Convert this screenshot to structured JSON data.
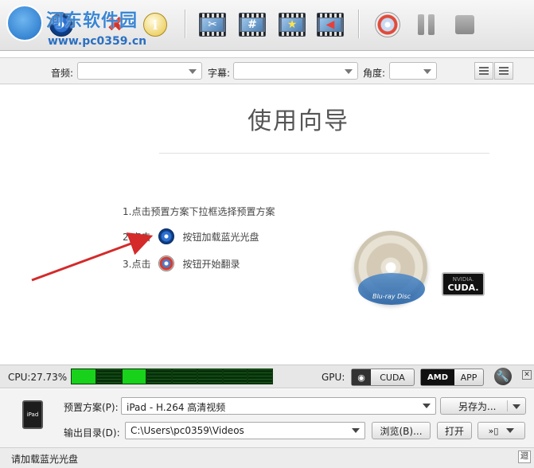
{
  "watermark": {
    "title": "河东软件园",
    "url": "www.pc0359.cn"
  },
  "toolbar": {
    "edit_symbol": "#",
    "info_symbol": "i"
  },
  "options": {
    "audio_label": "音频:",
    "subtitle_label": "字幕:",
    "angle_label": "角度:"
  },
  "guide": {
    "title": "使用向导",
    "step1": "1.点击预置方案下拉框选择预置方案",
    "step2_prefix": "2.点击",
    "step2_suffix": "按钮加载蓝光光盘",
    "step3_prefix": "3.点击",
    "step3_suffix": "按钮开始翻录",
    "bluray_text": "Blu-ray Disc",
    "cuda_top": "NVIDIA.",
    "cuda_main": "CUDA."
  },
  "perf": {
    "cpu_label": "CPU:27.73%",
    "cpu_active_blocks": [
      true,
      false,
      true,
      false,
      false,
      false,
      false,
      false
    ],
    "gpu_label": "GPU:",
    "cuda_label": "CUDA",
    "amd_label": "AMD",
    "app_label": "APP",
    "close_symbol": "✕"
  },
  "settings": {
    "device_label": "iPad",
    "preset_label": "预置方案(P):",
    "preset_value": "iPad - H.264 高清视频",
    "save_as_label": "另存为...",
    "output_label": "输出目录(D):",
    "output_value": "C:\\Users\\pc0359\\Videos",
    "browse_label": "浏览(B)...",
    "open_label": "打开"
  },
  "status": {
    "text": "请加载蓝光光盘",
    "right_symbol": "迴"
  }
}
